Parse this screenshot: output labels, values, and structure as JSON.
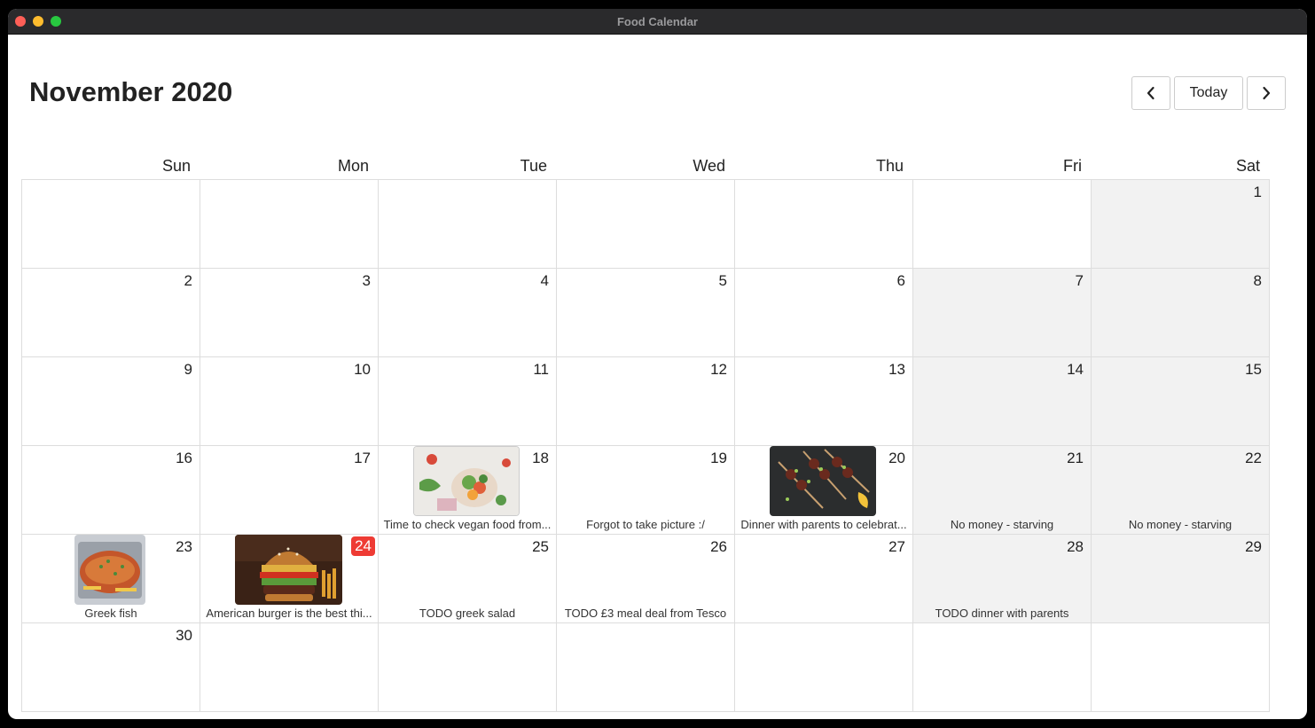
{
  "window": {
    "title": "Food Calendar"
  },
  "header": {
    "month_title": "November 2020",
    "today_label": "Today"
  },
  "weekdays": [
    "Sun",
    "Mon",
    "Tue",
    "Wed",
    "Thu",
    "Fri",
    "Sat"
  ],
  "days": [
    {
      "n": "",
      "shade": false
    },
    {
      "n": "",
      "shade": false
    },
    {
      "n": "",
      "shade": false
    },
    {
      "n": "",
      "shade": false
    },
    {
      "n": "",
      "shade": false
    },
    {
      "n": "",
      "shade": false
    },
    {
      "n": "1",
      "shade": true
    },
    {
      "n": "2",
      "shade": false
    },
    {
      "n": "3",
      "shade": false
    },
    {
      "n": "4",
      "shade": false
    },
    {
      "n": "5",
      "shade": false
    },
    {
      "n": "6",
      "shade": false
    },
    {
      "n": "7",
      "shade": true
    },
    {
      "n": "8",
      "shade": true
    },
    {
      "n": "9",
      "shade": false
    },
    {
      "n": "10",
      "shade": false
    },
    {
      "n": "11",
      "shade": false
    },
    {
      "n": "12",
      "shade": false
    },
    {
      "n": "13",
      "shade": false
    },
    {
      "n": "14",
      "shade": true
    },
    {
      "n": "15",
      "shade": true
    },
    {
      "n": "16",
      "shade": false
    },
    {
      "n": "17",
      "shade": false
    },
    {
      "n": "18",
      "shade": false,
      "photo": "salad-photo",
      "caption": "Time to check vegan food from..."
    },
    {
      "n": "19",
      "shade": false,
      "caption": "Forgot to take picture :/"
    },
    {
      "n": "20",
      "shade": false,
      "photo": "skewers-photo",
      "caption": "Dinner with parents to celebrat..."
    },
    {
      "n": "21",
      "shade": true,
      "caption": "No money - starving"
    },
    {
      "n": "22",
      "shade": true,
      "caption": "No money - starving"
    },
    {
      "n": "23",
      "shade": false,
      "photo": "fish-photo",
      "caption": "Greek fish"
    },
    {
      "n": "24",
      "shade": false,
      "today": true,
      "photo": "burger-photo",
      "caption": "American burger is the best thi..."
    },
    {
      "n": "25",
      "shade": false,
      "caption": "TODO greek salad"
    },
    {
      "n": "26",
      "shade": false,
      "caption": "TODO £3 meal deal from Tesco"
    },
    {
      "n": "27",
      "shade": false
    },
    {
      "n": "28",
      "shade": true,
      "caption": "TODO dinner with parents"
    },
    {
      "n": "29",
      "shade": true
    },
    {
      "n": "30",
      "shade": false
    },
    {
      "n": "",
      "shade": false
    },
    {
      "n": "",
      "shade": false
    },
    {
      "n": "",
      "shade": false
    },
    {
      "n": "",
      "shade": false
    },
    {
      "n": "",
      "shade": false
    },
    {
      "n": "",
      "shade": false
    }
  ],
  "colors": {
    "today_badge": "#ee3b34",
    "weekend_shade": "#f2f2f2"
  }
}
